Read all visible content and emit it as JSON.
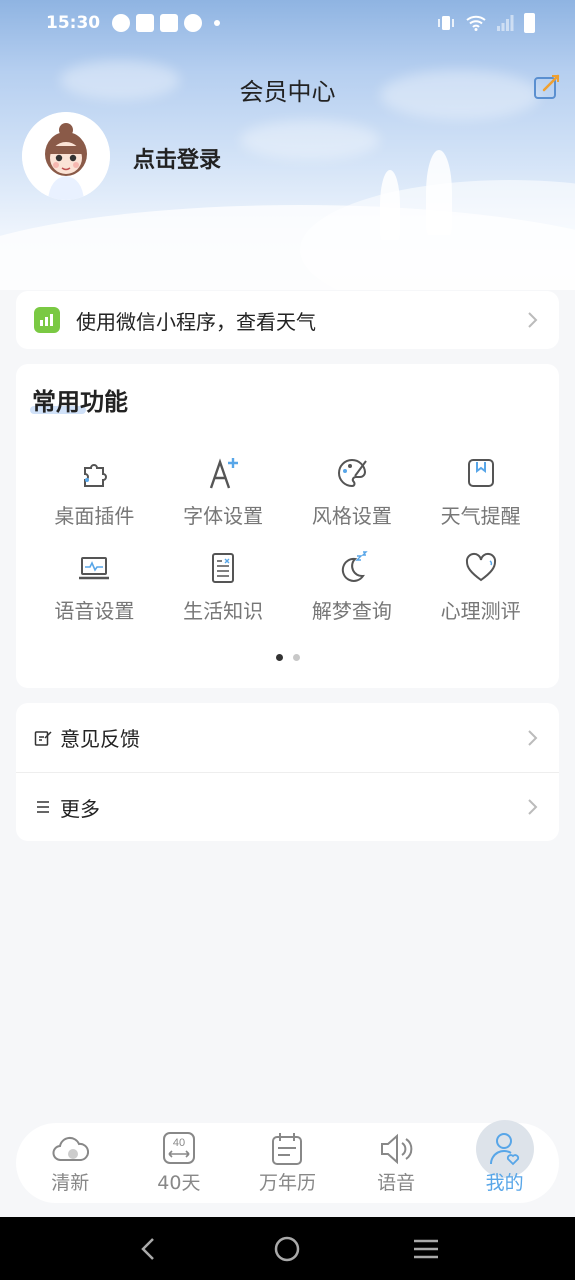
{
  "status_bar": {
    "time": "15:30"
  },
  "header": {
    "title": "会员中心",
    "login_text": "点击登录"
  },
  "mini_program": {
    "text": "使用微信小程序，查看天气"
  },
  "functions": {
    "title": "常用功能",
    "items": [
      {
        "label": "桌面插件",
        "icon": "puzzle-icon"
      },
      {
        "label": "字体设置",
        "icon": "font-icon"
      },
      {
        "label": "风格设置",
        "icon": "palette-icon"
      },
      {
        "label": "天气提醒",
        "icon": "bookmark-icon"
      },
      {
        "label": "语音设置",
        "icon": "laptop-icon"
      },
      {
        "label": "生活知识",
        "icon": "document-icon"
      },
      {
        "label": "解梦查询",
        "icon": "moon-icon"
      },
      {
        "label": "心理测评",
        "icon": "heart-icon"
      }
    ],
    "page_count": 2,
    "current_page": 1
  },
  "list": [
    {
      "label": "意见反馈",
      "icon": "feedback-icon"
    },
    {
      "label": "更多",
      "icon": "menu-icon"
    }
  ],
  "tabs": [
    {
      "label": "清新",
      "icon": "cloud-icon"
    },
    {
      "label": "40天",
      "icon": "forty-day-icon",
      "badge": "40"
    },
    {
      "label": "万年历",
      "icon": "calendar-icon"
    },
    {
      "label": "语音",
      "icon": "speaker-icon"
    },
    {
      "label": "我的",
      "icon": "profile-icon",
      "active": true
    }
  ],
  "colors": {
    "accent": "#58a6e8",
    "mini_program_icon": "#7ac943"
  }
}
